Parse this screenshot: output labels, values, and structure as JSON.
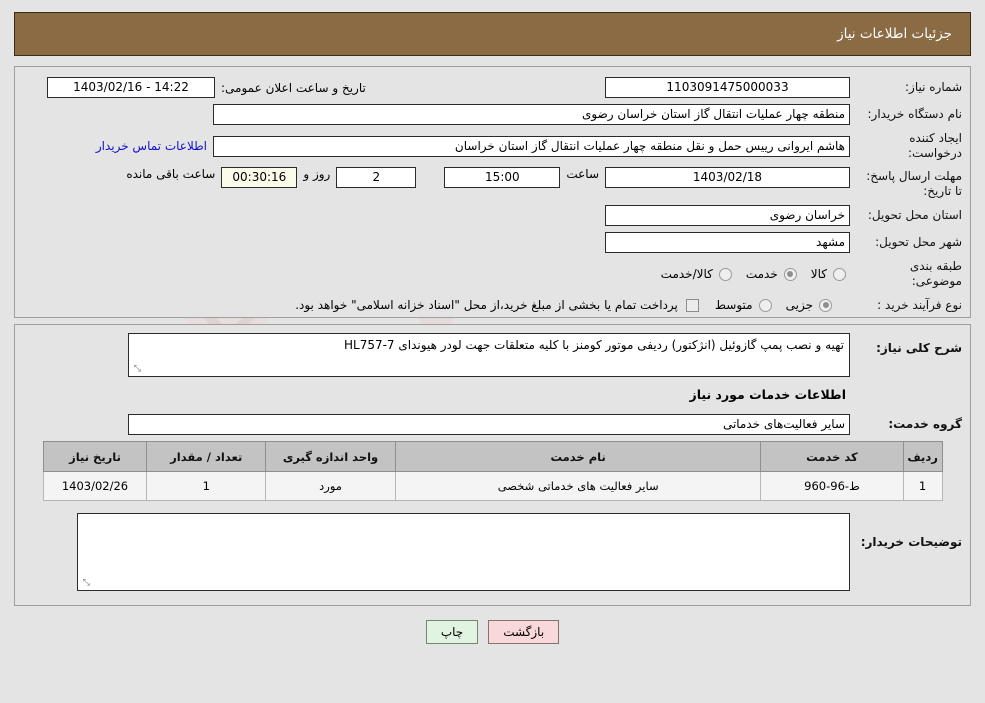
{
  "header": {
    "title": "جزئیات اطلاعات نیاز"
  },
  "form": {
    "need_number_label": "شماره نیاز:",
    "need_number": "1103091475000033",
    "announce_label": "تاریخ و ساعت اعلان عمومی:",
    "announce_value": "14:22 - 1403/02/16",
    "buyer_org_label": "نام دستگاه خریدار:",
    "buyer_org": "منطقه چهار عملیات انتقال گاز   استان خراسان رضوی",
    "creator_label": "ایجاد کننده درخواست:",
    "creator": "هاشم ایروانی رییس حمل و نقل منطقه چهار عملیات انتقال گاز   استان خراسان",
    "contact_link": "اطلاعات تماس خریدار",
    "deadline_label": "مهلت ارسال پاسخ: تا تاریخ:",
    "deadline_date": "1403/02/18",
    "hour_label": "ساعت",
    "deadline_time": "15:00",
    "days_left": "2",
    "days_and_label": "روز و",
    "countdown": "00:30:16",
    "remaining_label": "ساعت باقی مانده",
    "province_label": "استان محل تحویل:",
    "province": "خراسان رضوی",
    "city_label": "شهر محل تحویل:",
    "city": "مشهد",
    "category_label": "طبقه بندی موضوعی:",
    "category_options": [
      {
        "label": "کالا",
        "selected": false
      },
      {
        "label": "خدمت",
        "selected": true
      },
      {
        "label": "کالا/خدمت",
        "selected": false
      }
    ],
    "process_label": "نوع فرآیند خرید :",
    "process_options": [
      {
        "label": "جزیی",
        "selected": true
      },
      {
        "label": "متوسط",
        "selected": false
      }
    ],
    "treasury_checked": false,
    "treasury_note": "پرداخت تمام یا بخشی از مبلغ خرید،از محل \"اسناد خزانه اسلامی\" خواهد بود."
  },
  "details": {
    "summary_label": "شرح کلی نیاز:",
    "summary_value": "تهیه و نصب پمپ گازوئیل (انژکتور) ردیفی موتور کومنز با کلیه متعلقات جهت لودر هیوندای HL757-7",
    "services_heading": "اطلاعات خدمات مورد نیاز",
    "service_group_label": "گروه خدمت:",
    "service_group_value": "سایر فعالیت‌های خدماتی",
    "table": {
      "headers": [
        "ردیف",
        "کد خدمت",
        "نام خدمت",
        "واحد اندازه گیری",
        "تعداد / مقدار",
        "تاریخ نیاز"
      ],
      "rows": [
        [
          "1",
          "ط-96-960",
          "سایر فعالیت های خدماتی شخصی",
          "مورد",
          "1",
          "1403/02/26"
        ]
      ]
    },
    "buyer_notes_label": "توضیحات خریدار:",
    "buyer_notes_value": ""
  },
  "buttons": {
    "back": "بازگشت",
    "print": "چاپ"
  },
  "watermark": {
    "text": "AriaTender.net"
  },
  "colors": {
    "header_bg": "#8b6b43",
    "page_bg": "#e4e4e4",
    "link": "#1111cc",
    "back_btn": "#f8d8d8",
    "print_btn": "#e1f3e1"
  }
}
